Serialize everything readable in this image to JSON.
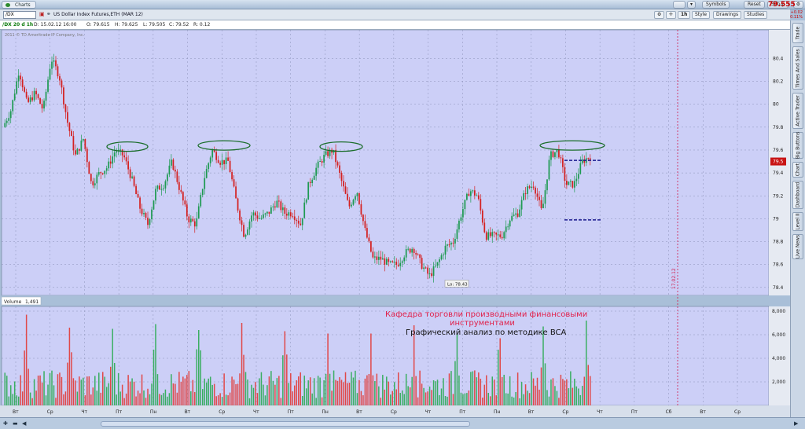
{
  "window": {
    "tab_label": "Charts"
  },
  "top_buttons": {
    "symbols": "Symbols",
    "reset": "Reset",
    "setup": "Setup"
  },
  "toolbar": {
    "symbol": "/DX",
    "description": "US Dollar Index Futures,ETH (MAR 12)",
    "timeframe": "1h",
    "style": "Style",
    "drawings": "Drawings",
    "studies": "Studies",
    "last_price": "79.555",
    "change_line1": "+0.02",
    "change_line2": "0.11%"
  },
  "infobar": {
    "name": "/DX 20 d 1h",
    "date": "D: 15.02.12 16:00",
    "open": "O: 79.615",
    "high": "H: 79.625",
    "low": "L: 79.505",
    "close": "C: 79.52",
    "range": "R: 0.12"
  },
  "copyright": "2011 © TD Ameritrade IP Company, Inc.",
  "sidebar": [
    "Trade",
    "Times And Sales",
    "Active Trader",
    "Big Buttons",
    "Chart",
    "Dashboard",
    "Level II",
    "Live News"
  ],
  "annotations": {
    "low_label": "Lo: 78.43",
    "date_marker": "17.02.12",
    "caption_red": "Кафедра торговли производными финансовыми инструментами",
    "caption_black": "Графический анализ по методике BCA"
  },
  "volume_panel": {
    "label": "Volume",
    "value": "1,491"
  },
  "chart_data": [
    {
      "type": "candlestick",
      "symbol": "/DX",
      "interval": "1h",
      "ylim": [
        78.33,
        80.65
      ],
      "yticks": [
        78.4,
        78.6,
        78.8,
        79,
        79.2,
        79.4,
        79.6,
        79.8,
        80,
        80.2,
        80.4
      ],
      "ytick_labels": [
        "78.4",
        "78.6",
        "78.8",
        "79",
        "79.2",
        "79.4",
        "79.6",
        "79.8",
        "80",
        "80.2",
        "80.4"
      ],
      "grid": true,
      "price_marker": 79.5,
      "price_marker_label": "79.5",
      "approx_close_path": [
        [
          0,
          79.8
        ],
        [
          2,
          79.95
        ],
        [
          4,
          80.3
        ],
        [
          6,
          80.0
        ],
        [
          8,
          80.1
        ],
        [
          10,
          79.95
        ],
        [
          12,
          80.4
        ],
        [
          14,
          80.25
        ],
        [
          16,
          79.85
        ],
        [
          18,
          79.55
        ],
        [
          20,
          79.7
        ],
        [
          22,
          79.3
        ],
        [
          24,
          79.4
        ],
        [
          26,
          79.45
        ],
        [
          28,
          79.6
        ],
        [
          30,
          79.55
        ],
        [
          32,
          79.35
        ],
        [
          34,
          79.1
        ],
        [
          36,
          78.95
        ],
        [
          38,
          79.25
        ],
        [
          40,
          79.3
        ],
        [
          42,
          79.5
        ],
        [
          44,
          79.25
        ],
        [
          46,
          79.0
        ],
        [
          48,
          78.95
        ],
        [
          50,
          79.35
        ],
        [
          52,
          79.6
        ],
        [
          54,
          79.5
        ],
        [
          56,
          79.5
        ],
        [
          58,
          79.15
        ],
        [
          60,
          78.85
        ],
        [
          62,
          79.05
        ],
        [
          64,
          79.0
        ],
        [
          66,
          79.05
        ],
        [
          68,
          79.15
        ],
        [
          70,
          79.05
        ],
        [
          72,
          79.05
        ],
        [
          74,
          78.95
        ],
        [
          76,
          79.3
        ],
        [
          78,
          79.45
        ],
        [
          80,
          79.55
        ],
        [
          82,
          79.6
        ],
        [
          84,
          79.35
        ],
        [
          86,
          79.1
        ],
        [
          88,
          79.25
        ],
        [
          90,
          78.9
        ],
        [
          92,
          78.65
        ],
        [
          94,
          78.65
        ],
        [
          96,
          78.6
        ],
        [
          98,
          78.6
        ],
        [
          100,
          78.7
        ],
        [
          102,
          78.75
        ],
        [
          104,
          78.6
        ],
        [
          106,
          78.5
        ],
        [
          108,
          78.6
        ],
        [
          110,
          78.75
        ],
        [
          112,
          78.8
        ],
        [
          114,
          79.05
        ],
        [
          116,
          79.25
        ],
        [
          118,
          79.2
        ],
        [
          120,
          78.85
        ],
        [
          122,
          78.85
        ],
        [
          124,
          78.85
        ],
        [
          126,
          79.0
        ],
        [
          128,
          79.05
        ],
        [
          130,
          79.25
        ],
        [
          132,
          79.3
        ],
        [
          134,
          79.05
        ],
        [
          136,
          79.55
        ],
        [
          138,
          79.6
        ],
        [
          140,
          79.3
        ],
        [
          142,
          79.3
        ],
        [
          144,
          79.5
        ],
        [
          146,
          79.55
        ]
      ],
      "xtick_labels": [
        "Вт",
        "Ср",
        "Чт",
        "Пт",
        "Пн",
        "Вт",
        "Ср",
        "Чт",
        "Пт",
        "Пн",
        "Вт",
        "Ср",
        "Чт",
        "Пт",
        "Пн",
        "Вт",
        "Ср",
        "Чт",
        "Пт",
        "Сб",
        "Вт",
        "Ср"
      ],
      "resistance_ellipses_price": [
        79.63,
        79.64,
        79.63,
        79.64
      ],
      "dashed_levels": [
        79.51,
        78.99
      ],
      "colors": {
        "up": "#1e9a52",
        "down": "#d42020",
        "background": "#cccff7",
        "ellipse": "#1a6d2a",
        "dashed": "#1b1b8f"
      }
    },
    {
      "type": "bar",
      "name": "Volume",
      "ylim": [
        0,
        8400
      ],
      "yticks": [
        2000,
        4000,
        6000,
        8000
      ],
      "ytick_labels": [
        "2,000",
        "4,000",
        "6,000",
        "8,000"
      ],
      "xtick_labels": [
        "Вт",
        "Ср",
        "Чт",
        "Пт",
        "Пн",
        "Вт",
        "Ср",
        "Чт",
        "Пт",
        "Пн",
        "Вт",
        "Ср",
        "Чт",
        "Пт",
        "Пн",
        "Вт",
        "Ср",
        "Чт",
        "Пт",
        "Сб",
        "Вт",
        "Ср"
      ],
      "peaks": [
        7700,
        6600,
        6500,
        6900,
        6400,
        7000,
        6300,
        6100,
        6100,
        6800,
        6000,
        5700,
        6700,
        7200
      ]
    }
  ]
}
